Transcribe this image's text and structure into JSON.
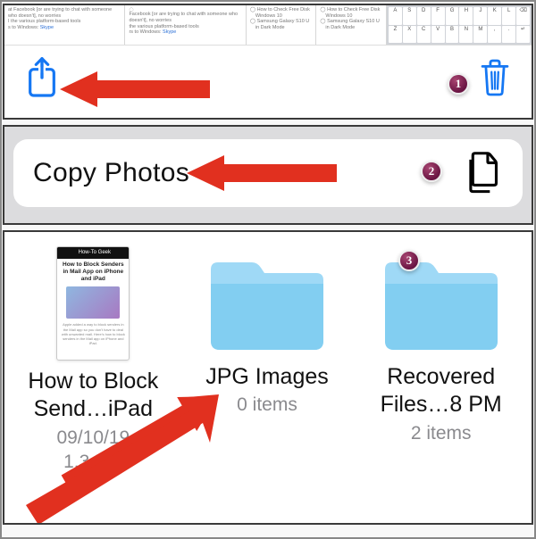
{
  "panel1": {
    "tabs": [
      {
        "line1": "at Facebook [or are trying to chat with someone who doesn't], no worries",
        "line2": "I the various platform-based tools",
        "linklabel": "s to Windows:",
        "link": "Skype"
      },
      {
        "line1": "Facebook [or are trying to chat with someone who doesn't], no worries",
        "line2": "the various platform-based tools",
        "linklabel": "rs to Windows:",
        "link": "Skype"
      },
      {
        "l1": "How to Check Free Disk",
        "l2": "Windows 10",
        "l3": "Samsung Galaxy S10 U",
        "l4": "in Dark Mode"
      },
      {
        "l1": "How to Check Free Disk",
        "l2": "Windows 10",
        "l3": "Samsung Galaxy S10 U",
        "l4": "in Dark Mode"
      }
    ],
    "keyboard": [
      "A",
      "S",
      "D",
      "F",
      "G",
      "H",
      "J",
      "K",
      "L",
      "⌫",
      "Z",
      "X",
      "C",
      "V",
      "B",
      "N",
      "M",
      ",",
      ".",
      "↵"
    ],
    "badge": "1"
  },
  "panel2": {
    "label": "Copy Photos",
    "badge": "2"
  },
  "panel3": {
    "badge": "3",
    "items": [
      {
        "kind": "doc",
        "thumb_site": "How-To Geek",
        "thumb_title": "How to Block Senders in Mail App on iPhone and iPad",
        "name": "How to Block\nSend…iPad",
        "meta": "09/10/19\n1.3 MB"
      },
      {
        "kind": "folder",
        "name": "JPG Images",
        "meta": "0 items"
      },
      {
        "kind": "folder",
        "name": "Recovered\nFiles…8 PM",
        "meta": "2 items"
      }
    ]
  }
}
